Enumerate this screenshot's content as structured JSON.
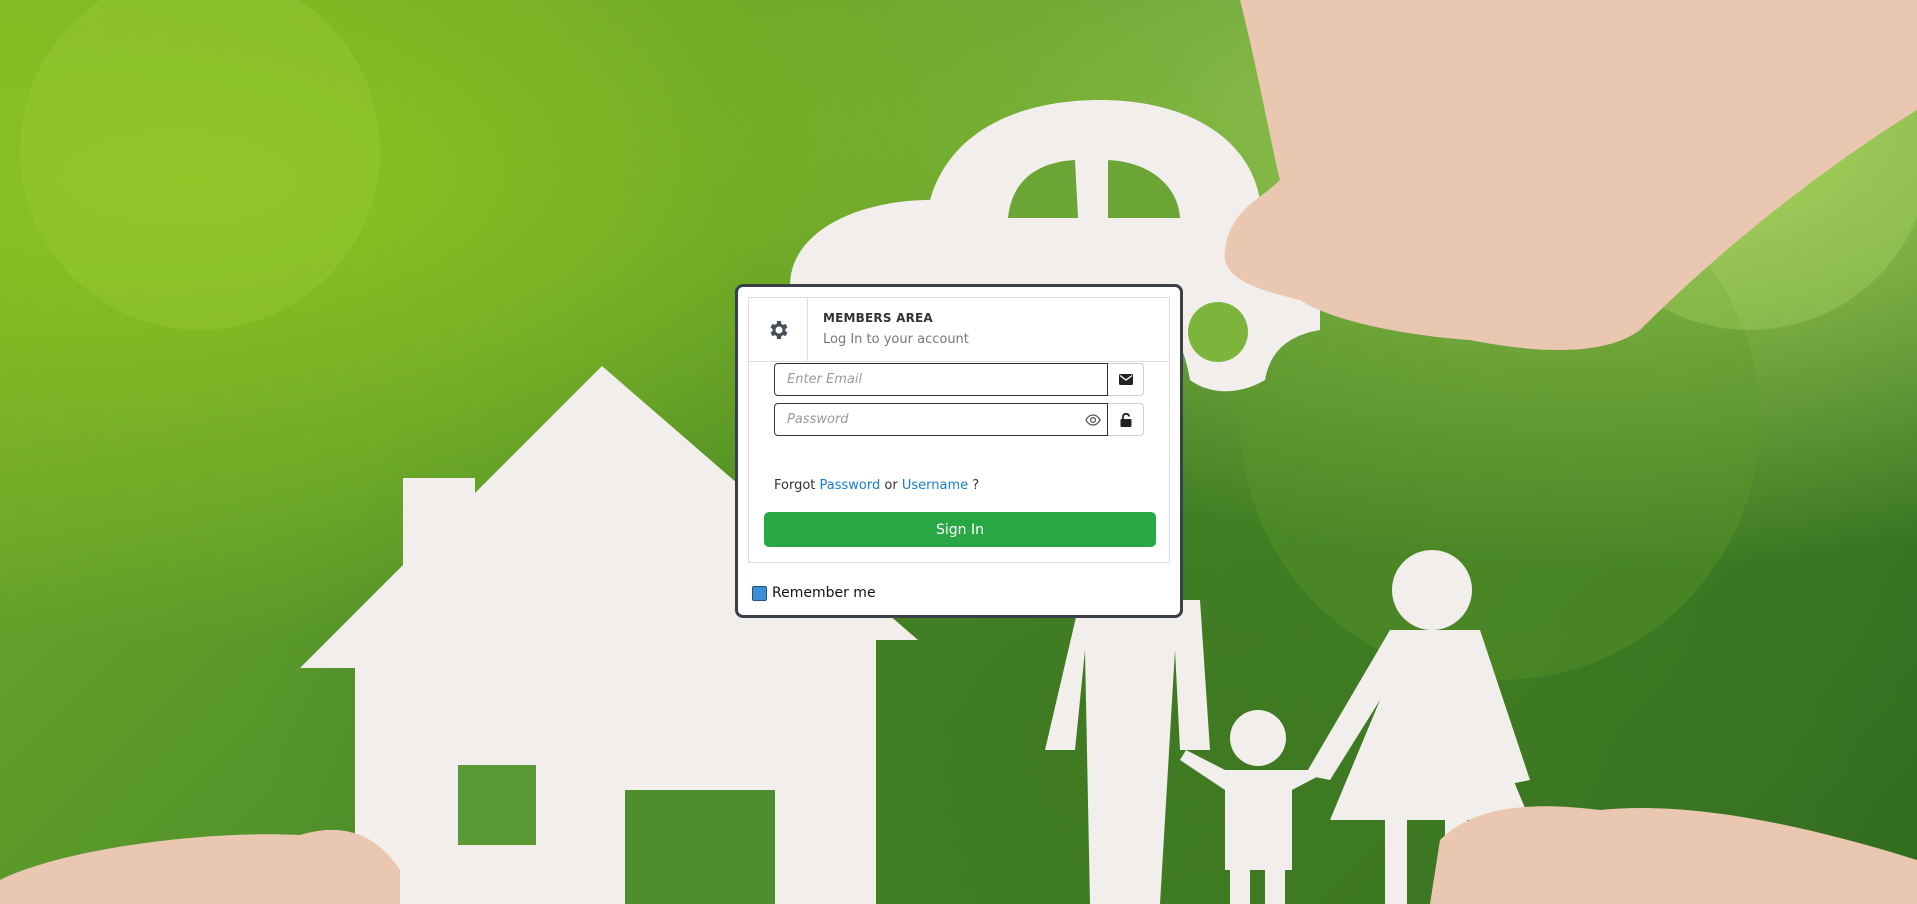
{
  "header": {
    "title": "MEMBERS AREA",
    "subtitle": "Log In to your account",
    "icon": "gear-icon"
  },
  "form": {
    "email_placeholder": "Enter Email",
    "email_icon": "envelope-icon",
    "password_placeholder": "Password",
    "password_toggle_icon": "eye-icon",
    "password_icon": "unlock-icon",
    "forgot_prefix": "Forgot",
    "forgot_password_link": "Password",
    "forgot_or": "or",
    "forgot_username_link": "Username",
    "forgot_suffix": "?",
    "signin_label": "Sign In",
    "remember_label": "Remember me",
    "remember_checked": true
  },
  "colors": {
    "accent_green": "#28a745",
    "link_blue": "#1a7bd1",
    "card_border": "#3a3f4a",
    "checkbox_fill": "#3b8fd8"
  }
}
